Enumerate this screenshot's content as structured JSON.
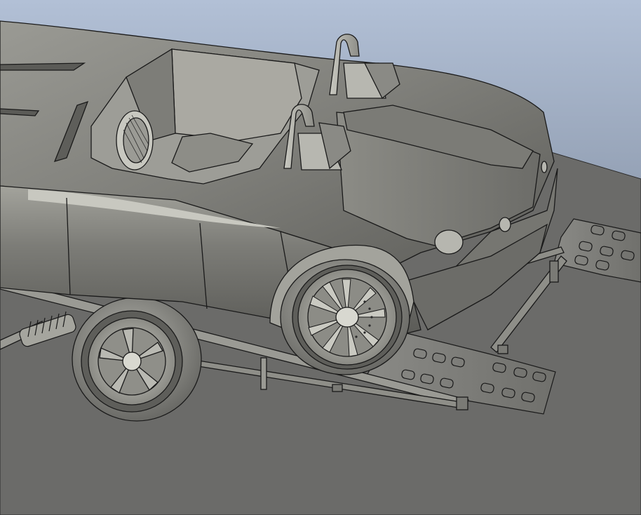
{
  "viewport": {
    "label": "",
    "background_top": "#a9b7cc",
    "background_bottom": "#6e7480",
    "ground_color": "#6b6b69",
    "body_color": "#8c8c87",
    "line_color": "#1a1a1a"
  },
  "scene": {
    "objects": [
      {
        "name": "roadster-body"
      },
      {
        "name": "trailer-frame"
      },
      {
        "name": "loading-ramp-front"
      },
      {
        "name": "loading-ramp-rear"
      },
      {
        "name": "car-front-wheel"
      },
      {
        "name": "trailer-wheel"
      },
      {
        "name": "roll-hoop-left"
      },
      {
        "name": "roll-hoop-right"
      },
      {
        "name": "suspension-spring"
      }
    ]
  }
}
